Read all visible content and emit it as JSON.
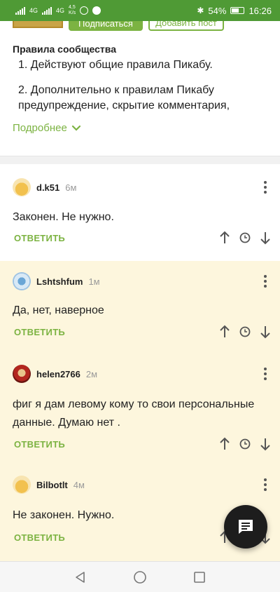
{
  "status_bar": {
    "net_label_1": "4G",
    "net_label_2": "4G",
    "speed_value": "4,5",
    "speed_unit": "K/s",
    "battery": "54%",
    "time": "16:26"
  },
  "header": {
    "subscribe_label": "Подписаться",
    "add_post_label": "Добавить пост"
  },
  "rules": {
    "title": "Правила сообщества",
    "item1": "1. Действуют общие правила Пикабу.",
    "item2": "2. Дополнительно к правилам Пикабу предупреждение, скрытие комментария,",
    "more_label": "Подробнее"
  },
  "comments": [
    {
      "username": "d.k51",
      "time": "6м",
      "text": "Законен. Не нужно.",
      "reply": "ОТВЕТИТЬ"
    },
    {
      "username": "Lshtshfum",
      "time": "1м",
      "text": "Да, нет, наверное",
      "reply": "ОТВЕТИТЬ"
    },
    {
      "username": "helen2766",
      "time": "2м",
      "text": "фиг я дам левому кому то свои персональные данные. Думаю нет .",
      "reply": "ОТВЕТИТЬ"
    },
    {
      "username": "Bilbotlt",
      "time": "4м",
      "text": "Не законен. Нужно.",
      "reply": "ОТВЕТИТЬ"
    }
  ],
  "colors": {
    "accent_green": "#7cb342",
    "status_green": "#4f9a35",
    "highlight_bg": "#fdf6dd",
    "fab_bg": "#1d1d1d"
  },
  "icons": {
    "fab": "comment-icon",
    "nav_back": "back-icon",
    "nav_home": "home-icon",
    "nav_recents": "recents-icon"
  }
}
